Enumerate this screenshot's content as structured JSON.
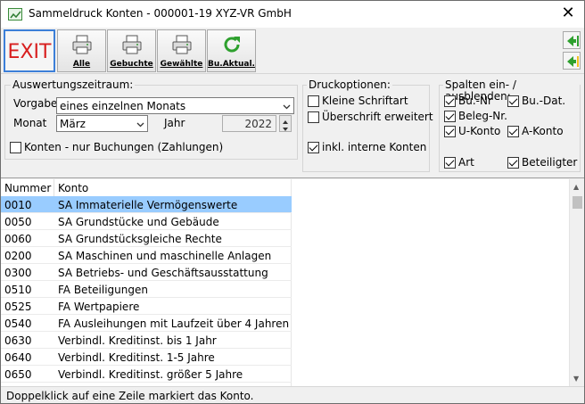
{
  "window": {
    "title": "Sammeldruck Konten - 000001-19 XYZ-VR GmbH"
  },
  "toolbar": {
    "exit_label": "EXIT",
    "buttons": [
      {
        "label": "Alle",
        "icon": "printer-icon"
      },
      {
        "label": "Gebuchte",
        "icon": "printer-icon"
      },
      {
        "label": "Gewählte",
        "icon": "printer-icon"
      },
      {
        "label": "Bu.Aktual.",
        "icon": "refresh-icon"
      }
    ],
    "accent": "#3c7fd8",
    "exit_color": "#d81e1e"
  },
  "auswertung": {
    "title": "Auswertungszeitraum:",
    "vorgabe_label": "Vorgabe",
    "vorgabe_value": "eines einzelnen Monats",
    "monat_label": "Monat",
    "monat_value": "März",
    "jahr_label": "Jahr",
    "jahr_value": "2022",
    "konten_checkbox": "Konten - nur Buchungen (Zahlungen)"
  },
  "druckoptionen": {
    "title": "Druckoptionen:",
    "kleine_schrift": "Kleine Schriftart",
    "ueberschrift": "Überschrift erweitert",
    "interne_konten": "inkl. interne Konten"
  },
  "spalten": {
    "title": "Spalten ein- / ausblenden:",
    "bu_nr": "Bu.-Nr",
    "bu_dat": "Bu.-Dat.",
    "beleg_nr": "Beleg-Nr.",
    "u_konto": "U-Konto",
    "a_konto": "A-Konto",
    "art": "Art",
    "beteiligter": "Beteiligter"
  },
  "table": {
    "headers": {
      "nummer": "Nummer",
      "konto": "Konto"
    },
    "selection_color": "#99ccff",
    "rows": [
      {
        "nummer": "0010",
        "konto": "SA Immaterielle Vermögenswerte"
      },
      {
        "nummer": "0050",
        "konto": "SA Grundstücke und Gebäude"
      },
      {
        "nummer": "0060",
        "konto": "SA Grundstücksgleiche Rechte"
      },
      {
        "nummer": "0200",
        "konto": "SA Maschinen und maschinelle Anlagen"
      },
      {
        "nummer": "0300",
        "konto": "SA Betriebs- und Geschäftsausstattung"
      },
      {
        "nummer": "0510",
        "konto": "FA Beteiligungen"
      },
      {
        "nummer": "0525",
        "konto": "FA Wertpapiere"
      },
      {
        "nummer": "0540",
        "konto": "FA Ausleihungen mit Laufzeit über 4 Jahren"
      },
      {
        "nummer": "0630",
        "konto": "Verbindl. Kreditinst. bis 1 Jahr"
      },
      {
        "nummer": "0640",
        "konto": "Verbindl. Kreditinst. 1-5 Jahre"
      },
      {
        "nummer": "0650",
        "konto": "Verbindl. Kreditinst. größer 5 Jahre"
      }
    ]
  },
  "status": {
    "text": "Doppelklick auf eine Zeile markiert das Konto."
  }
}
